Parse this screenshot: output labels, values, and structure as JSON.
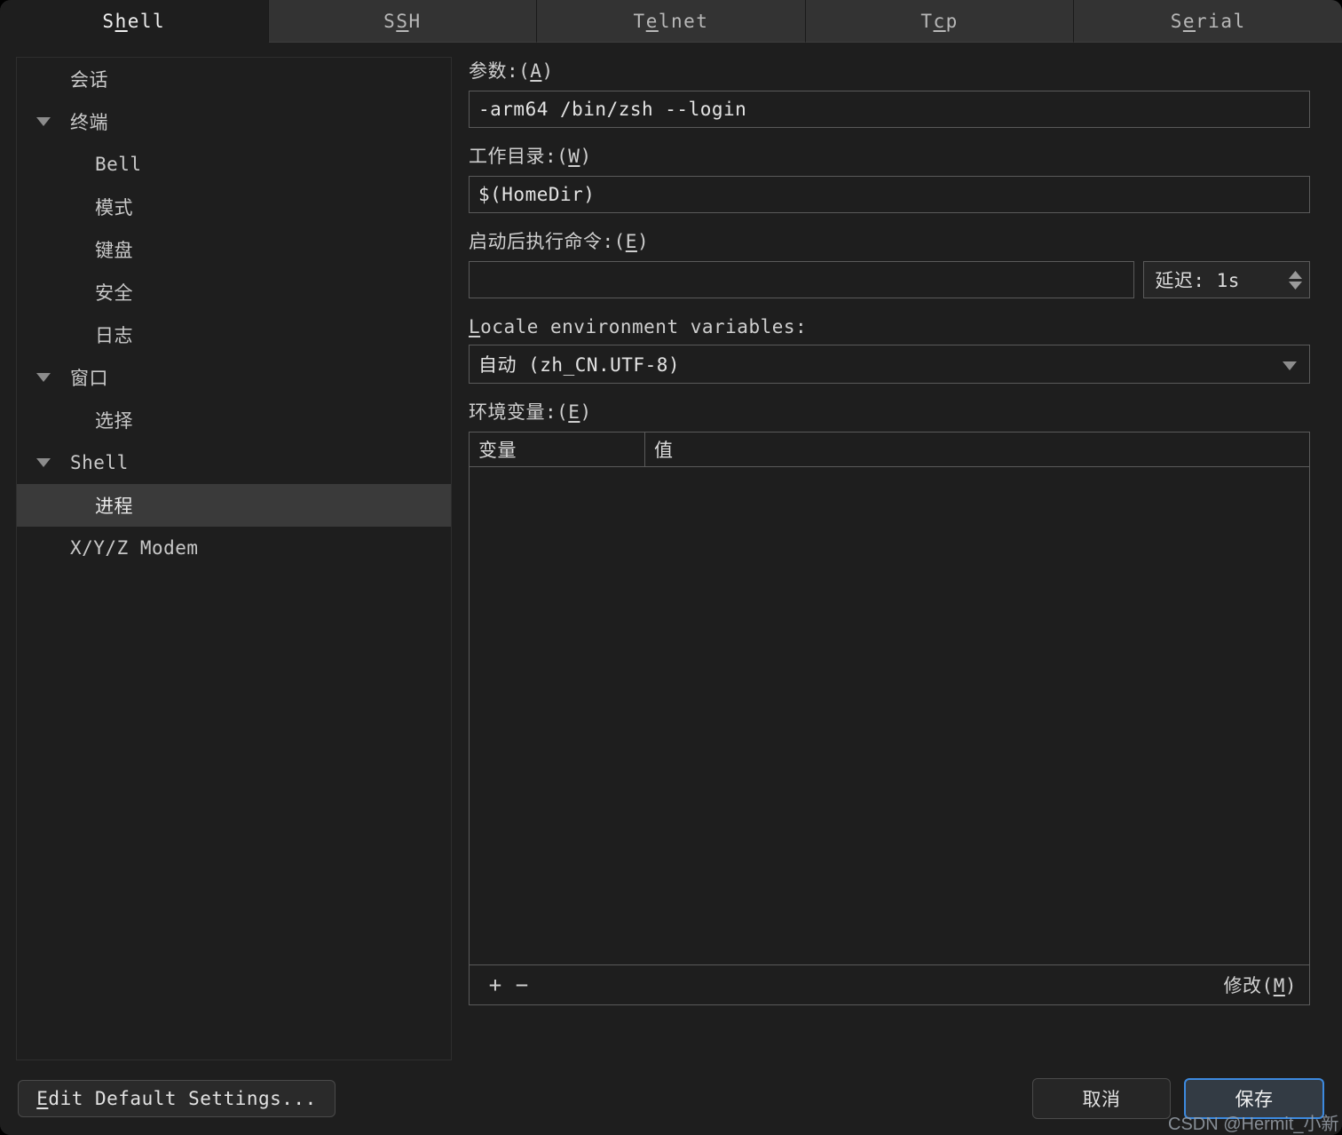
{
  "tabs": [
    {
      "label": "Shell",
      "pre": "S",
      "mnemonic": "h",
      "post": "ell",
      "active": true
    },
    {
      "label": "SSH",
      "pre": "S",
      "mnemonic": "S",
      "post": "H",
      "active": false
    },
    {
      "label": "Telnet",
      "pre": "T",
      "mnemonic": "e",
      "post": "lnet",
      "active": false
    },
    {
      "label": "Tcp",
      "pre": "T",
      "mnemonic": "c",
      "post": "p",
      "active": false
    },
    {
      "label": "Serial",
      "pre": "S",
      "mnemonic": "e",
      "post": "rial",
      "active": false
    }
  ],
  "sidebar": {
    "items": [
      {
        "label": "会话",
        "level": 0,
        "expandable": false,
        "expanded": false,
        "selected": false
      },
      {
        "label": "终端",
        "level": 0,
        "expandable": true,
        "expanded": true,
        "selected": false
      },
      {
        "label": "Bell",
        "level": 1,
        "expandable": false,
        "expanded": false,
        "selected": false
      },
      {
        "label": "模式",
        "level": 1,
        "expandable": false,
        "expanded": false,
        "selected": false
      },
      {
        "label": "键盘",
        "level": 1,
        "expandable": false,
        "expanded": false,
        "selected": false
      },
      {
        "label": "安全",
        "level": 1,
        "expandable": false,
        "expanded": false,
        "selected": false
      },
      {
        "label": "日志",
        "level": 1,
        "expandable": false,
        "expanded": false,
        "selected": false
      },
      {
        "label": "窗口",
        "level": 0,
        "expandable": true,
        "expanded": true,
        "selected": false
      },
      {
        "label": "选择",
        "level": 1,
        "expandable": false,
        "expanded": false,
        "selected": false
      },
      {
        "label": "Shell",
        "level": 0,
        "expandable": true,
        "expanded": true,
        "selected": false
      },
      {
        "label": "进程",
        "level": 1,
        "expandable": false,
        "expanded": false,
        "selected": true
      },
      {
        "label": "X/Y/Z Modem",
        "level": 0,
        "expandable": false,
        "expanded": false,
        "selected": false
      }
    ]
  },
  "pane": {
    "args": {
      "label_pre": "参数:(",
      "label_mnemonic": "A",
      "label_post": ")",
      "value": "-arm64 /bin/zsh --login",
      "placeholder": ""
    },
    "workdir": {
      "label_pre": "工作目录:(",
      "label_mnemonic": "W",
      "label_post": ")",
      "value": "$(HomeDir)",
      "placeholder": ""
    },
    "startup_command": {
      "label_pre": "启动后执行命令:(",
      "label_mnemonic": "E",
      "label_post": ")",
      "value": "",
      "placeholder": ""
    },
    "delay": {
      "value": "延迟: 1s"
    },
    "locale": {
      "label_pre": "",
      "label_mnemonic": "L",
      "label_post": "ocale environment variables:",
      "selected": "自动 (zh_CN.UTF-8)"
    },
    "env": {
      "label_pre": "环境变量:(",
      "label_mnemonic": "E",
      "label_post": ")",
      "columns": [
        "变量",
        "值"
      ],
      "rows": [],
      "add_label": "+",
      "remove_label": "−",
      "modify_pre": "修改(",
      "modify_mnemonic": "M",
      "modify_post": ")"
    }
  },
  "footer": {
    "edit_default_pre": "",
    "edit_default_mnemonic": "E",
    "edit_default_post": "dit Default Settings...",
    "cancel_label": "取消",
    "save_label": "保存"
  },
  "watermark": "CSDN @Hermit_小新",
  "colors": {
    "window_bg": "#1e1e1e",
    "tab_inactive_bg": "#333333",
    "selection_bg": "#3a3a3a",
    "border": "#5a5a5a",
    "accent_focus": "#3d8adf",
    "text": "#e2e2e2"
  }
}
